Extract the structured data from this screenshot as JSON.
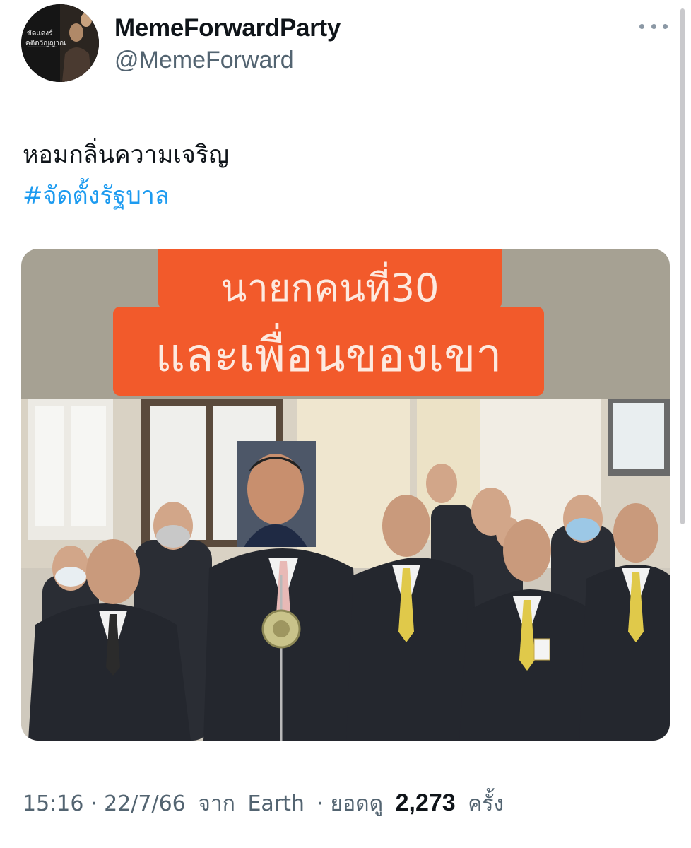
{
  "tweet": {
    "avatar_caption": [
      "ขัดแดงร์",
      "คติดวิญญาณ"
    ],
    "display_name": "MemeForwardParty",
    "handle": "@MemeForward",
    "text": "หอมกลิ่นความเจริญ",
    "hashtag": "#จัดตั้งรัฐบาล",
    "more_icon": "more-horizontal-icon",
    "media": {
      "banner_line1": "นายกคนที่30",
      "banner_line2": "และเพื่อนของเขา"
    },
    "meta": {
      "time": "15:16",
      "date": "22/7/66",
      "source_prefix": "จาก",
      "source": "Earth",
      "views_label": "ยอดดู",
      "views": "2,273",
      "views_suffix": "ครั้ง"
    }
  },
  "colors": {
    "hashtag": "#1d9bf0",
    "muted_text": "#536471",
    "banner": "#f25a2b"
  }
}
